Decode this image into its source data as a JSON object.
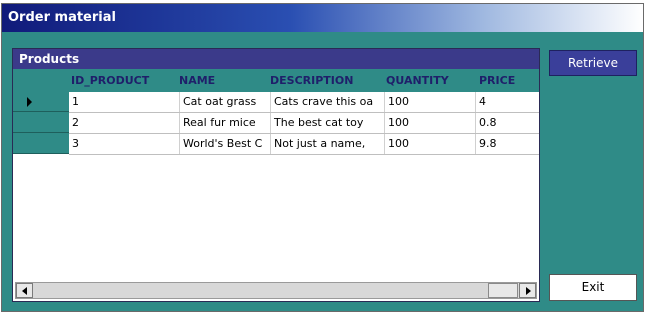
{
  "window": {
    "title": "Order material"
  },
  "grid": {
    "caption": "Products",
    "columns": [
      "ID_PRODUCT",
      "NAME",
      "DESCRIPTION",
      "QUANTITY",
      "PRICE"
    ],
    "rows": [
      [
        "1",
        "Cat oat grass",
        "Cats crave this oa",
        "100",
        "4"
      ],
      [
        "2",
        "Real fur mice",
        "The best cat toy",
        "100",
        "0.8"
      ],
      [
        "3",
        "World's Best C",
        "Not just a name,",
        "100",
        "9.8"
      ]
    ],
    "current_row_marker": "arrow-right"
  },
  "buttons": {
    "retrieve_label": "Retrieve",
    "exit_label": "Exit"
  },
  "colors": {
    "window_bg": "#2f8b87",
    "caption_bg": "#3b3a8a",
    "title_gradient_start": "#101a7a",
    "retrieve_bg": "#3a3f9a"
  }
}
